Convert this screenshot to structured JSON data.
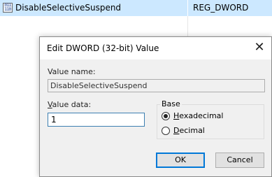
{
  "registry_row": {
    "icon_text": "011 110",
    "name": "DisableSelectiveSuspend",
    "type": "REG_DWORD"
  },
  "dialog": {
    "title": "Edit DWORD (32-bit) Value",
    "close_icon": "✕",
    "value_name_label": "Value name:",
    "value_name": "DisableSelectiveSuspend",
    "value_data_label_u": "V",
    "value_data_label_rest": "alue data:",
    "value_data": "1",
    "base_label": "Base",
    "radio_hex_u": "H",
    "radio_hex_rest": "exadecimal",
    "radio_dec_u": "D",
    "radio_dec_rest": "ecimal",
    "selected_base": "Hexadecimal",
    "ok_label": "OK",
    "cancel_label": "Cancel"
  }
}
